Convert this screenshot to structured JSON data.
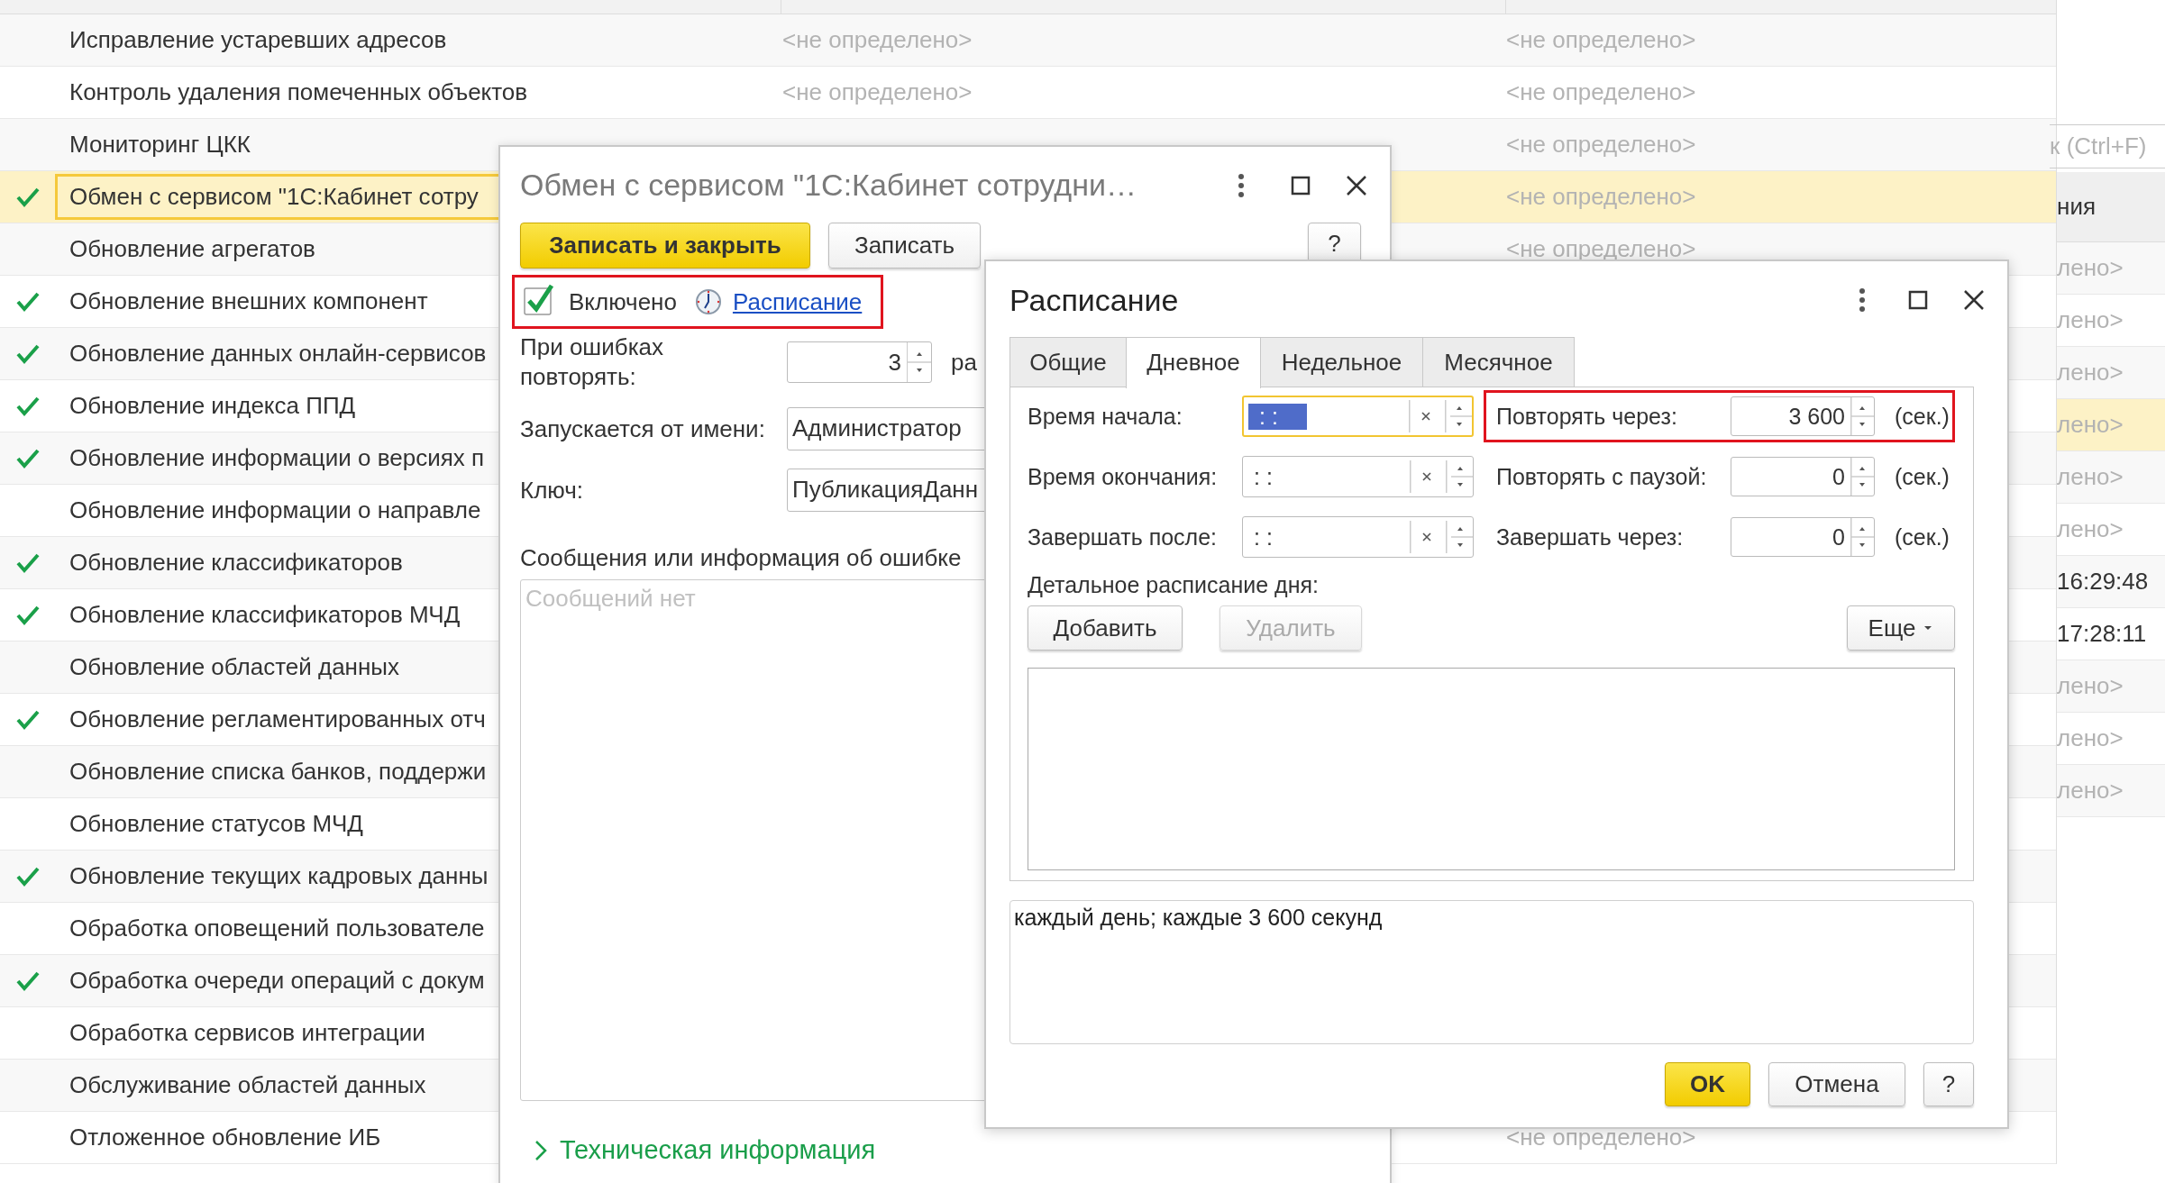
{
  "task_list": {
    "rows": [
      {
        "name": "Исправление устаревших адресов",
        "enabled": false,
        "selected": false,
        "column_2": "<не определено>",
        "column_3": "<не определено>"
      },
      {
        "name": "Контроль удаления помеченных объектов",
        "enabled": false,
        "selected": false,
        "column_2": "<не определено>",
        "column_3": "<не определено>"
      },
      {
        "name": "Мониторинг ЦКК",
        "enabled": false,
        "selected": false,
        "column_3": "<не определено>"
      },
      {
        "name": "Обмен с сервисом \"1С:Кабинет сотру",
        "enabled": true,
        "selected": true,
        "column_3": "<не определено>"
      },
      {
        "name": "Обновление агрегатов",
        "enabled": false,
        "selected": false,
        "column_3": "<не определено>"
      },
      {
        "name": "Обновление внешних компонент",
        "enabled": true,
        "selected": false
      },
      {
        "name": "Обновление данных онлайн-сервисов",
        "enabled": true,
        "selected": false
      },
      {
        "name": "Обновление индекса ППД",
        "enabled": true,
        "selected": false
      },
      {
        "name": "Обновление информации о версиях п",
        "enabled": true,
        "selected": false
      },
      {
        "name": "Обновление информации о направле",
        "enabled": false,
        "selected": false
      },
      {
        "name": "Обновление классификаторов",
        "enabled": true,
        "selected": false
      },
      {
        "name": "Обновление классификаторов МЧД",
        "enabled": true,
        "selected": false
      },
      {
        "name": "Обновление областей данных",
        "enabled": false,
        "selected": false
      },
      {
        "name": "Обновление регламентированных отч",
        "enabled": true,
        "selected": false
      },
      {
        "name": "Обновление списка банков, поддержи",
        "enabled": false,
        "selected": false
      },
      {
        "name": "Обновление статусов МЧД",
        "enabled": false,
        "selected": false
      },
      {
        "name": "Обновление текущих кадровых данны",
        "enabled": true,
        "selected": false
      },
      {
        "name": "Обработка оповещений пользователе",
        "enabled": false,
        "selected": false
      },
      {
        "name": "Обработка очереди операций с докум",
        "enabled": true,
        "selected": false
      },
      {
        "name": "Обработка сервисов интеграции",
        "enabled": false,
        "selected": false
      },
      {
        "name": "Обслуживание областей данных",
        "enabled": false,
        "selected": false
      },
      {
        "name": "Отложенное обновление ИБ",
        "enabled": false,
        "selected": false,
        "column_3": "<не определено>"
      }
    ]
  },
  "side_panel": {
    "search": {
      "placeholder": "к (Ctrl+F)"
    },
    "header": "ния",
    "rows": [
      {
        "value": "лено>",
        "selected": false
      },
      {
        "value": "лено>",
        "selected": false
      },
      {
        "value": "лено>",
        "selected": false
      },
      {
        "value": "лено>",
        "selected": true
      },
      {
        "value": "лено>",
        "selected": false
      },
      {
        "value": "лено>",
        "selected": false
      },
      {
        "value": "16:29:48",
        "selected": false
      },
      {
        "value": "17:28:11",
        "selected": false
      },
      {
        "value": "лено>",
        "selected": false
      },
      {
        "value": "лено>",
        "selected": false
      },
      {
        "value": "лено>",
        "selected": false
      }
    ]
  },
  "task_dialog": {
    "title": "Обмен с сервисом \"1С:Кабинет сотрудни…",
    "buttons": [
      {
        "label": "Записать и закрыть",
        "kind": "primary"
      },
      {
        "label": "Записать",
        "kind": "default"
      }
    ],
    "help": "?",
    "enabled": {
      "label": "Включено",
      "checked": true
    },
    "schedule_link": "Расписание",
    "retry": {
      "label": "При ошибках повторять:",
      "value": "3",
      "unit": "ра"
    },
    "user": {
      "label": "Запускается от имени:",
      "value": "Администратор"
    },
    "key": {
      "label": "Ключ:",
      "value": "ПубликацияДанн"
    },
    "messages": {
      "label": "Сообщения или информация об ошибке",
      "placeholder": "Сообщений нет"
    },
    "tech_info": {
      "label": "Техническая информация",
      "expanded": false
    }
  },
  "schedule_dialog": {
    "title": "Расписание",
    "tabs": [
      {
        "label": "Общие",
        "selected": false
      },
      {
        "label": "Дневное",
        "selected": true
      },
      {
        "label": "Недельное",
        "selected": false
      },
      {
        "label": "Месячное",
        "selected": false
      }
    ],
    "time_fields": [
      {
        "label": "Время начала:",
        "value": ": :",
        "focused": true
      },
      {
        "label": "Время окончания:",
        "value": ": :",
        "focused": false
      },
      {
        "label": "Завершать после:",
        "value": ": :",
        "focused": false
      }
    ],
    "interval_fields": [
      {
        "label": "Повторять через:",
        "value": "3 600",
        "unit": "(сек.)"
      },
      {
        "label": "Повторять с паузой:",
        "value": "0",
        "unit": "(сек.)"
      },
      {
        "label": "Завершать через:",
        "value": "0",
        "unit": "(сек.)"
      }
    ],
    "detail_label": "Детальное расписание дня:",
    "list_buttons": [
      {
        "label": "Добавить",
        "disabled": false
      },
      {
        "label": "Удалить",
        "disabled": true
      }
    ],
    "more_button": "Еще",
    "summary": "каждый день; каждые 3 600 секунд",
    "footer_buttons": [
      {
        "label": "OK",
        "kind": "primary"
      },
      {
        "label": "Отмена",
        "kind": "default"
      },
      {
        "label": "?",
        "kind": "help"
      }
    ]
  }
}
